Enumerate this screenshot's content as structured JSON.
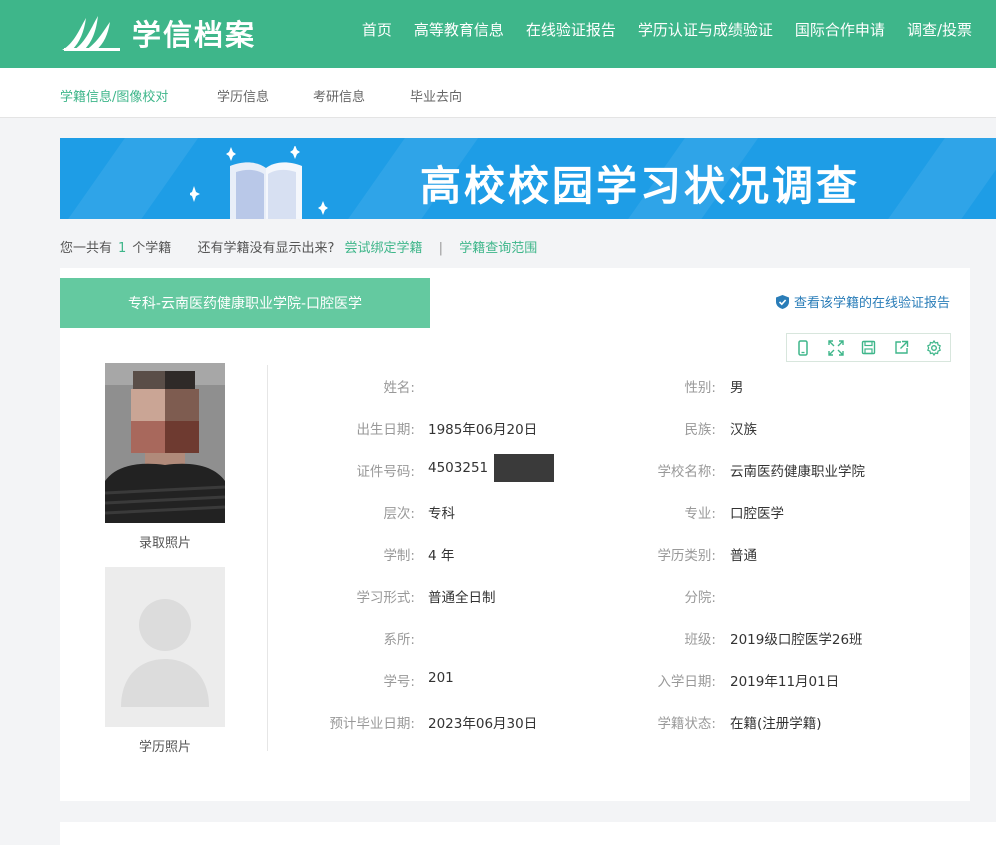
{
  "header": {
    "logo_text": "学信档案",
    "nav": [
      "首页",
      "高等教育信息",
      "在线验证报告",
      "学历认证与成绩验证",
      "国际合作申请",
      "调查/投票"
    ]
  },
  "subnav": {
    "items": [
      "学籍信息/图像校对",
      "学历信息",
      "考研信息",
      "毕业去向"
    ]
  },
  "banner": {
    "title": "高校校园学习状况调查"
  },
  "info": {
    "prefix": "您一共有",
    "count": "1",
    "suffix": "个学籍",
    "question": "还有学籍没有显示出来?",
    "bind_link": "尝试绑定学籍",
    "separator": "|",
    "range_link": "学籍查询范围"
  },
  "record": {
    "tab_title": "专科-云南医药健康职业学院-口腔医学",
    "verify_link": "查看该学籍的在线验证报告",
    "toolbar_icons": [
      "mobile-icon",
      "fullscreen-icon",
      "save-icon",
      "share-icon",
      "settings-icon"
    ],
    "photo1_caption": "录取照片",
    "photo2_caption": "学历照片",
    "left_fields": [
      {
        "label": "姓名:",
        "value": ""
      },
      {
        "label": "出生日期:",
        "value": "1985年06月20日"
      },
      {
        "label": "证件号码:",
        "value": "4503251"
      },
      {
        "label": "层次:",
        "value": "专科"
      },
      {
        "label": "学制:",
        "value": "4 年"
      },
      {
        "label": "学习形式:",
        "value": "普通全日制"
      },
      {
        "label": "系所:",
        "value": ""
      },
      {
        "label": "学号:",
        "value": "201"
      },
      {
        "label": "预计毕业日期:",
        "value": "2023年06月30日"
      }
    ],
    "right_fields": [
      {
        "label": "性别:",
        "value": "男"
      },
      {
        "label": "民族:",
        "value": "汉族"
      },
      {
        "label": "学校名称:",
        "value": "云南医药健康职业学院"
      },
      {
        "label": "专业:",
        "value": "口腔医学"
      },
      {
        "label": "学历类别:",
        "value": "普通"
      },
      {
        "label": "分院:",
        "value": ""
      },
      {
        "label": "班级:",
        "value": "2019级口腔医学26班"
      },
      {
        "label": "入学日期:",
        "value": "2019年11月01日"
      },
      {
        "label": "学籍状态:",
        "value": "在籍(注册学籍)"
      }
    ]
  },
  "colors": {
    "brand_green": "#3eb68a",
    "tab_green": "#64c9a0",
    "banner_blue": "#1e9de6",
    "link_blue": "#2a7db8"
  }
}
